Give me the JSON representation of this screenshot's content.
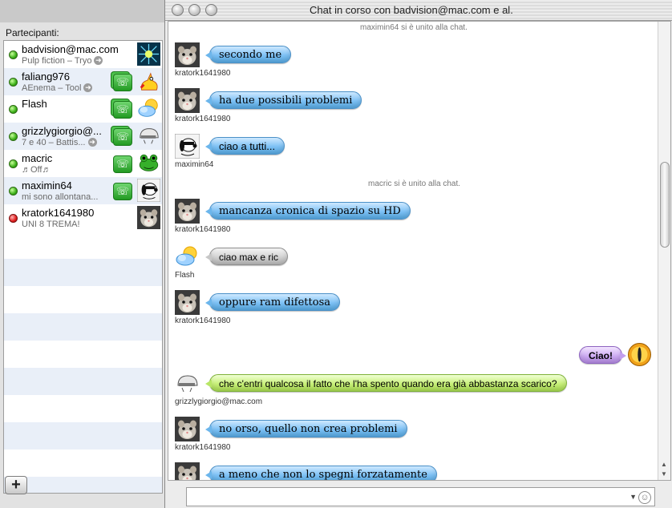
{
  "window": {
    "title": "Chat in corso con badvision@mac.com e al."
  },
  "participants": {
    "label": "Partecipanti:",
    "items": [
      {
        "name": "badvision@mac.com",
        "status": "Pulp fiction – Tryo",
        "presence": "available",
        "arrow": true,
        "video": false,
        "avatar": "starburst"
      },
      {
        "name": "faliang976",
        "status": "AEnema – Tool",
        "presence": "available",
        "arrow": true,
        "video": true,
        "multi": true,
        "avatar": "cartoon"
      },
      {
        "name": "Flash",
        "status": "",
        "presence": "available",
        "arrow": false,
        "video": true,
        "multi": true,
        "avatar": "weather"
      },
      {
        "name": "grizzlygiorgio@...",
        "status": "7 e 40 – Battis...",
        "presence": "available",
        "arrow": true,
        "video": true,
        "multi": true,
        "avatar": "helmet"
      },
      {
        "name": "macric",
        "status": "♬Off♬",
        "presence": "available",
        "arrow": false,
        "video": true,
        "multi": false,
        "avatar": "frog"
      },
      {
        "name": "maximin64",
        "status": "mi sono allontana...",
        "presence": "available",
        "arrow": false,
        "video": true,
        "multi": false,
        "avatar": "snoopy"
      },
      {
        "name": "kratork1641980",
        "status": "UNI 8 TREMA!",
        "presence": "busy",
        "arrow": false,
        "video": false,
        "avatar": "hamster"
      }
    ]
  },
  "add_button": {
    "label": "+"
  },
  "messages": [
    {
      "kind": "notice",
      "text": "maximin64 si è unito alla chat."
    },
    {
      "kind": "msg",
      "user": "kratork1641980",
      "text": "secondo me",
      "style": "blue hand",
      "avatar": "hamster"
    },
    {
      "kind": "msg",
      "user": "kratork1641980",
      "text": "ha due possibili problemi",
      "style": "blue hand",
      "avatar": "hamster"
    },
    {
      "kind": "msg",
      "user": "maximin64",
      "text": "ciao a tutti...",
      "style": "blue",
      "avatar": "snoopy"
    },
    {
      "kind": "notice",
      "text": "macric si è unito alla chat."
    },
    {
      "kind": "msg",
      "user": "kratork1641980",
      "text": "mancanza cronica di spazio su HD",
      "style": "blue hand",
      "avatar": "hamster"
    },
    {
      "kind": "msg",
      "user": "Flash",
      "text": "ciao max e ric",
      "style": "gray",
      "avatar": "weather"
    },
    {
      "kind": "msg",
      "user": "kratork1641980",
      "text": "oppure ram difettosa",
      "style": "blue hand",
      "avatar": "hamster"
    },
    {
      "kind": "self",
      "text": "Ciao!",
      "style": "purple",
      "avatar": "eye"
    },
    {
      "kind": "msg",
      "user": "grizzlygiorgio@mac.com",
      "text": "che c'entri qualcosa il fatto che l'ha spento quando era già abbastanza scarico?",
      "style": "green",
      "avatar": "helmet"
    },
    {
      "kind": "msg",
      "user": "kratork1641980",
      "text": "no orso, quello non crea problemi",
      "style": "blue hand",
      "avatar": "hamster"
    },
    {
      "kind": "msg",
      "user": "kratork1641980",
      "text": "a meno che non lo spegni forzatamente",
      "style": "blue hand",
      "avatar": "hamster"
    }
  ],
  "input": {
    "value": ""
  },
  "icons": {
    "video_chat": "video-chat-icon",
    "status_arrow": "arrow-right-icon",
    "smiley": "smiley-icon",
    "menu": "triangle-down-icon"
  }
}
